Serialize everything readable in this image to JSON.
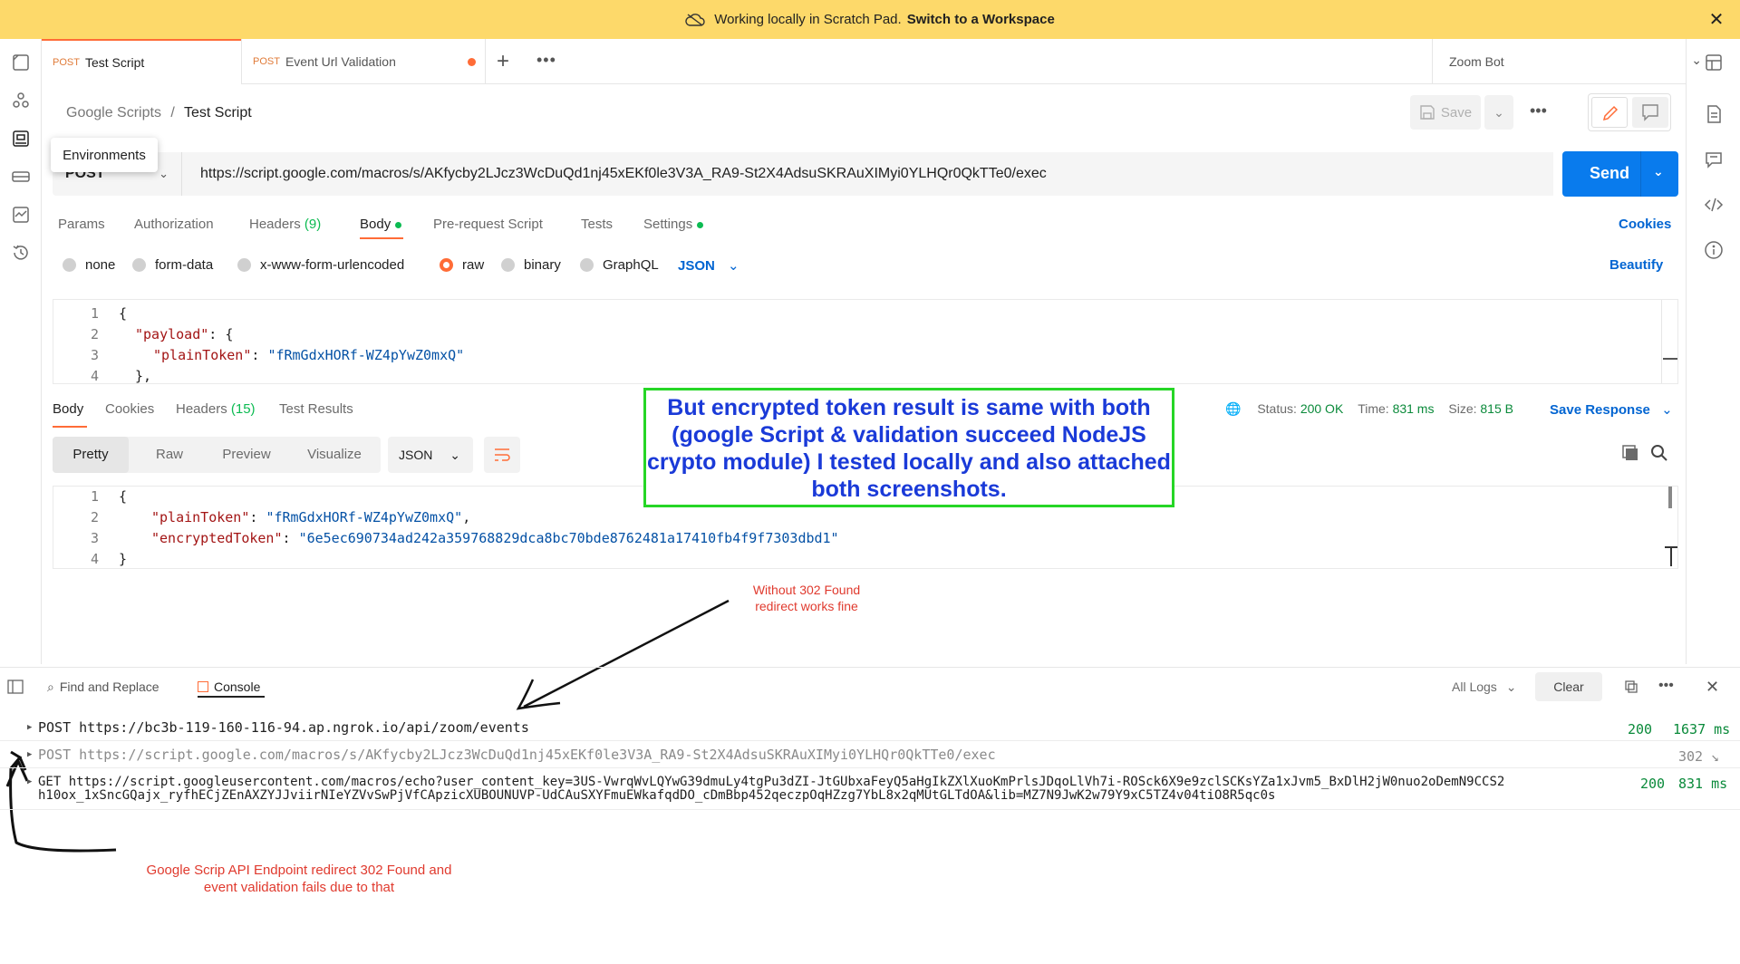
{
  "banner": {
    "text": "Working locally in Scratch Pad.",
    "link": "Switch to a Workspace"
  },
  "tabs": [
    {
      "method": "POST",
      "name": "Test Script"
    },
    {
      "method": "POST",
      "name": "Event Url Validation"
    }
  ],
  "environment": "Zoom Bot",
  "breadcrumb": {
    "parent": "Google Scripts",
    "sep": "/",
    "current": "Test Script"
  },
  "save_label": "Save",
  "tooltip": "Environments",
  "request": {
    "method": "POST",
    "url": "https://script.google.com/macros/s/AKfycby2LJcz3WcDuQd1nj45xEKf0le3V3A_RA9-St2X4AdsuSKRAuXIMyi0YLHQr0QkTTe0/exec",
    "send": "Send"
  },
  "request_tabs": {
    "params": "Params",
    "authorization": "Authorization",
    "headers": "Headers",
    "headers_count": "(9)",
    "body": "Body",
    "prerequest": "Pre-request Script",
    "tests": "Tests",
    "settings": "Settings",
    "cookies": "Cookies"
  },
  "body_types": {
    "none": "none",
    "form_data": "form-data",
    "urlencoded": "x-www-form-urlencoded",
    "raw": "raw",
    "binary": "binary",
    "graphql": "GraphQL",
    "lang": "JSON",
    "beautify": "Beautify"
  },
  "request_body": {
    "lines": [
      "1",
      "2",
      "3",
      "4"
    ],
    "l1": "{",
    "l2k": "\"payload\"",
    "l2r": ": {",
    "l3k": "\"plainToken\"",
    "l3c": ": ",
    "l3v": "\"fRmGdxHORf-WZ4pYwZ0mxQ\"",
    "l4": "},"
  },
  "response_tabs": {
    "body": "Body",
    "cookies": "Cookies",
    "headers": "Headers",
    "headers_count": "(15)",
    "test_results": "Test Results"
  },
  "status": {
    "status_label": "Status:",
    "status": "200 OK",
    "time_label": "Time:",
    "time": "831 ms",
    "size_label": "Size:",
    "size": "815 B",
    "save_response": "Save Response"
  },
  "format": {
    "pretty": "Pretty",
    "raw": "Raw",
    "preview": "Preview",
    "visualize": "Visualize",
    "lang": "JSON"
  },
  "response_body": {
    "lines": [
      "1",
      "2",
      "3",
      "4"
    ],
    "l1": "{",
    "l2k": "\"plainToken\"",
    "l2c": ": ",
    "l2v": "\"fRmGdxHORf-WZ4pYwZ0mxQ\"",
    "l2e": ",",
    "l3k": "\"encryptedToken\"",
    "l3c": ": ",
    "l3v": "\"6e5ec690734ad242a359768829dca8bc70bde8762481a17410fb4f9f7303dbd1\"",
    "l4": "}"
  },
  "annotation": "But encrypted token result is same with both (google Script & validation succeed NodeJS crypto module) I tested locally and also attached both screenshots.",
  "note_top": "Without 302 Found redirect works fine",
  "note_bottom": "Google Scrip API Endpoint redirect 302 Found and event validation fails due to that",
  "console": {
    "find_replace": "Find and Replace",
    "tab": "Console",
    "all_logs": "All Logs",
    "clear": "Clear",
    "rows": [
      {
        "text": "POST https://bc3b-119-160-116-94.ap.ngrok.io/api/zoom/events",
        "status": "200",
        "time": "1637 ms"
      },
      {
        "text": "POST https://script.google.com/macros/s/AKfycby2LJcz3WcDuQd1nj45xEKf0le3V3A_RA9-St2X4AdsuSKRAuXIMyi0YLHQr0QkTTe0/exec",
        "status": "302",
        "time": ""
      },
      {
        "text": "GET https://script.googleusercontent.com/macros/echo?user_content_key=3US-VwrqWvLQYwG39dmuLy4tgPu3dZI-JtGUbxaFeyQ5aHgIkZXlXuoKmPrlsJDqoLlVh7i-ROSck6X9e9zclSCKsYZa1xJvm5_BxDlH2jW0nuo2oDemN9CCS2\nh10ox_1xSncGQajx_ryfhECjZEnAXZYJJviirNIeYZVvSwPjVfCApzicXUBOUNUVP-UdCAuSXYFmuEWkafqdDO_cDmBbp452qeczpOqHZzg7YbL8x2qMUtGLTdOA&lib=MZ7N9JwK2w79Y9xC5TZ4v04tiO8R5qc0s",
        "status": "200",
        "time": "831 ms"
      }
    ]
  }
}
